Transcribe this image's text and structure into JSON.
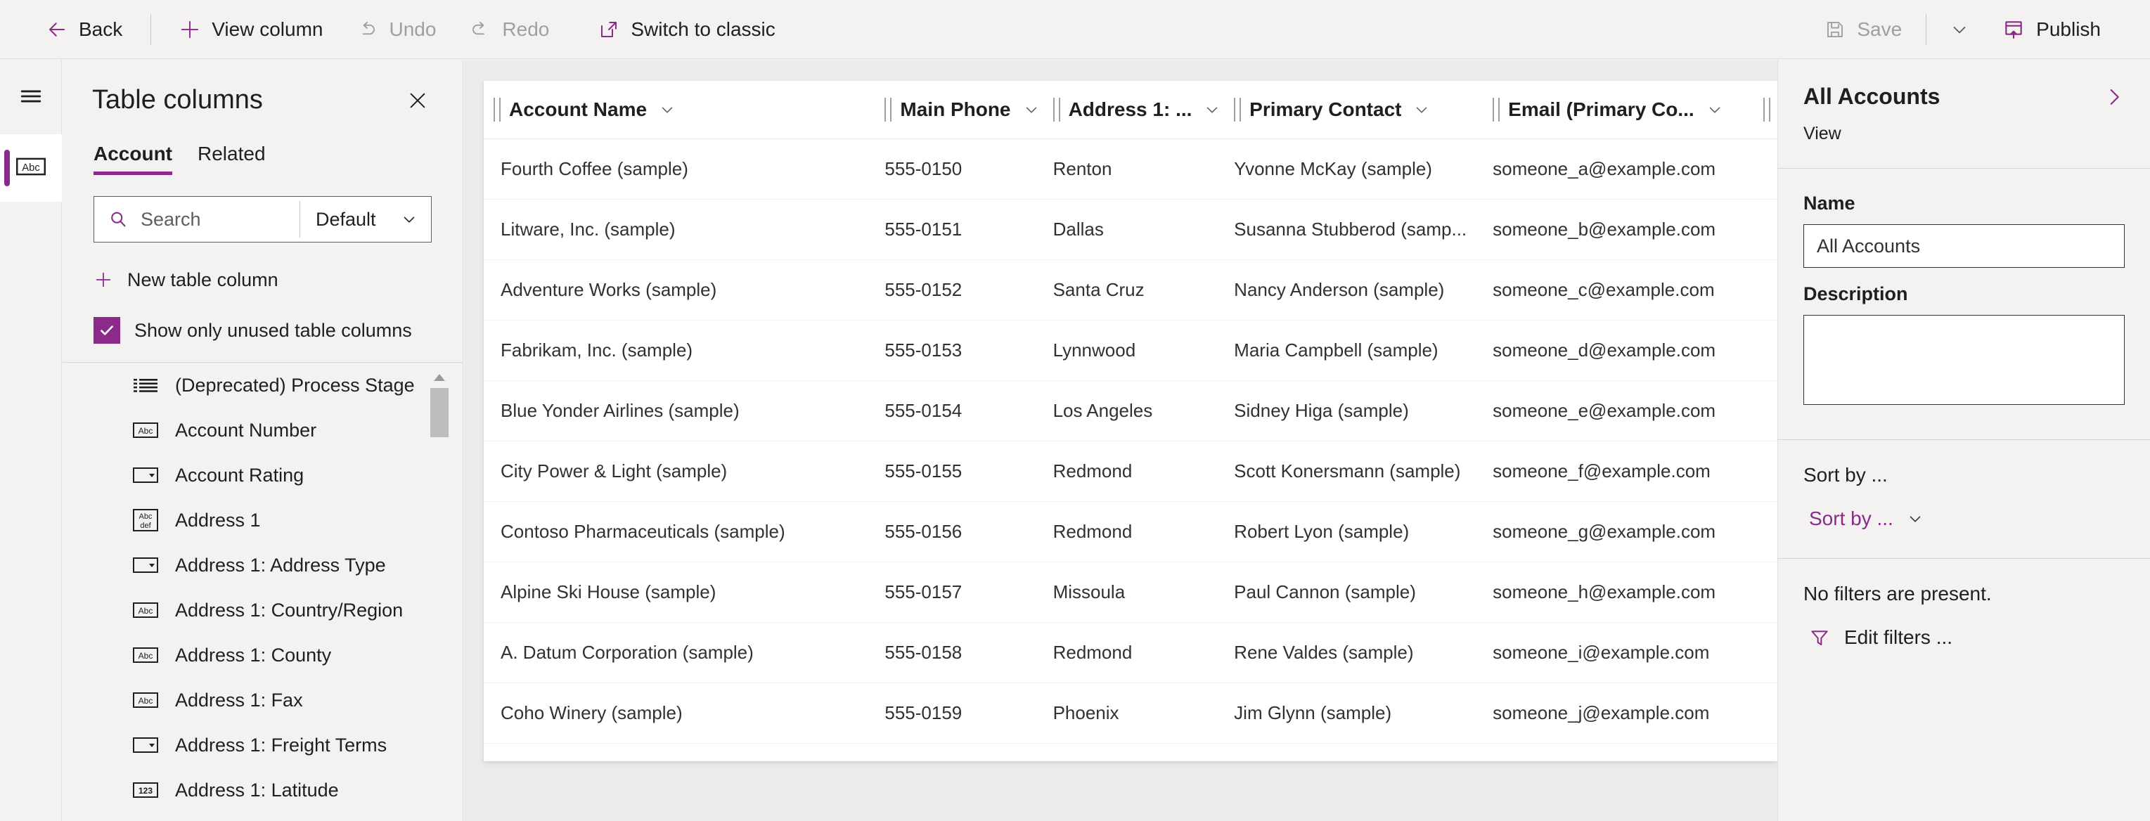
{
  "toolbar": {
    "back_label": "Back",
    "view_column_label": "View column",
    "undo_label": "Undo",
    "redo_label": "Redo",
    "switch_classic_label": "Switch to classic",
    "save_label": "Save",
    "publish_label": "Publish",
    "accent_color": "#8a2a8a"
  },
  "rail": {
    "hamburger_name": "hamburger-menu",
    "item_name": "columns-rail-item"
  },
  "columns_panel": {
    "title": "Table columns",
    "tabs": [
      {
        "label": "Account",
        "active": true
      },
      {
        "label": "Related",
        "active": false
      }
    ],
    "search_placeholder": "Search",
    "search_value": "",
    "filter_value": "Default",
    "new_column_label": "New table column",
    "show_unused_label": "Show only unused table columns",
    "show_unused_checked": true,
    "items": [
      {
        "label": "(Deprecated) Process Stage",
        "icon": "optionset-list-icon"
      },
      {
        "label": "Account Number",
        "icon": "text-abc-icon"
      },
      {
        "label": "Account Rating",
        "icon": "choice-dropdown-icon"
      },
      {
        "label": "Address 1",
        "icon": "multiline-text-abcdef-icon"
      },
      {
        "label": "Address 1: Address Type",
        "icon": "choice-dropdown-icon"
      },
      {
        "label": "Address 1: Country/Region",
        "icon": "text-abc-icon"
      },
      {
        "label": "Address 1: County",
        "icon": "text-abc-icon"
      },
      {
        "label": "Address 1: Fax",
        "icon": "text-abc-icon"
      },
      {
        "label": "Address 1: Freight Terms",
        "icon": "choice-dropdown-icon"
      },
      {
        "label": "Address 1: Latitude",
        "icon": "number-123-icon"
      }
    ]
  },
  "grid": {
    "columns": [
      {
        "header": "Account Name",
        "key": "account_name",
        "width": "31%"
      },
      {
        "header": "Main Phone",
        "key": "main_phone",
        "width": "13%"
      },
      {
        "header": "Address 1: ...",
        "key": "address1_city",
        "width": "14%"
      },
      {
        "header": "Primary Contact",
        "key": "primary_contact",
        "width": "20%"
      },
      {
        "header": "Email (Primary Co...",
        "key": "email",
        "width": "22%"
      }
    ],
    "rows": [
      {
        "account_name": "Fourth Coffee (sample)",
        "main_phone": "555-0150",
        "address1_city": "Renton",
        "primary_contact": "Yvonne McKay (sample)",
        "email": "someone_a@example.com"
      },
      {
        "account_name": "Litware, Inc. (sample)",
        "main_phone": "555-0151",
        "address1_city": "Dallas",
        "primary_contact": "Susanna Stubberod (samp...",
        "email": "someone_b@example.com"
      },
      {
        "account_name": "Adventure Works (sample)",
        "main_phone": "555-0152",
        "address1_city": "Santa Cruz",
        "primary_contact": "Nancy Anderson (sample)",
        "email": "someone_c@example.com"
      },
      {
        "account_name": "Fabrikam, Inc. (sample)",
        "main_phone": "555-0153",
        "address1_city": "Lynnwood",
        "primary_contact": "Maria Campbell (sample)",
        "email": "someone_d@example.com"
      },
      {
        "account_name": "Blue Yonder Airlines (sample)",
        "main_phone": "555-0154",
        "address1_city": "Los Angeles",
        "primary_contact": "Sidney Higa (sample)",
        "email": "someone_e@example.com"
      },
      {
        "account_name": "City Power & Light (sample)",
        "main_phone": "555-0155",
        "address1_city": "Redmond",
        "primary_contact": "Scott Konersmann (sample)",
        "email": "someone_f@example.com"
      },
      {
        "account_name": "Contoso Pharmaceuticals (sample)",
        "main_phone": "555-0156",
        "address1_city": "Redmond",
        "primary_contact": "Robert Lyon (sample)",
        "email": "someone_g@example.com"
      },
      {
        "account_name": "Alpine Ski House (sample)",
        "main_phone": "555-0157",
        "address1_city": "Missoula",
        "primary_contact": "Paul Cannon (sample)",
        "email": "someone_h@example.com"
      },
      {
        "account_name": "A. Datum Corporation (sample)",
        "main_phone": "555-0158",
        "address1_city": "Redmond",
        "primary_contact": "Rene Valdes (sample)",
        "email": "someone_i@example.com"
      },
      {
        "account_name": "Coho Winery (sample)",
        "main_phone": "555-0159",
        "address1_city": "Phoenix",
        "primary_contact": "Jim Glynn (sample)",
        "email": "someone_j@example.com"
      }
    ]
  },
  "properties_panel": {
    "title": "All Accounts",
    "subtitle": "View",
    "name_label": "Name",
    "name_value": "All Accounts",
    "description_label": "Description",
    "description_value": "",
    "sort_by_label": "Sort by ...",
    "sort_by_link": "Sort by ...",
    "no_filters_text": "No filters are present.",
    "edit_filters_label": "Edit filters ..."
  }
}
